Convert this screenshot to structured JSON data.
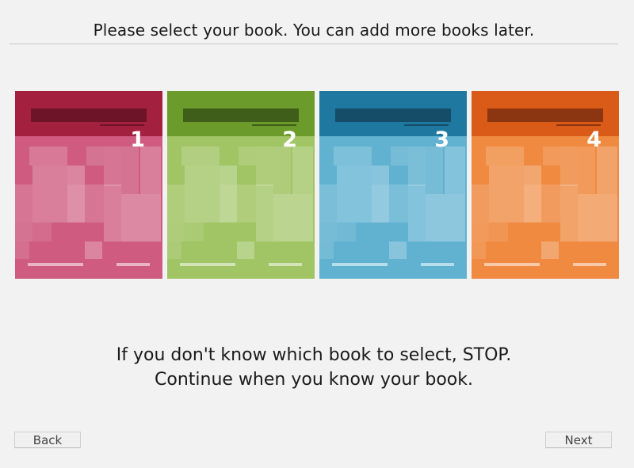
{
  "header": {
    "title": "Please select your book. You can add more books later."
  },
  "books": [
    {
      "number": "1",
      "top_color": "#a3213f",
      "body_color": "#cf5c80",
      "bar_color": "#6e1429",
      "line_color": "#6e1429"
    },
    {
      "number": "2",
      "top_color": "#6b9b2a",
      "body_color": "#a1c464",
      "bar_color": "#3f5e19",
      "line_color": "#3f5e19"
    },
    {
      "number": "3",
      "top_color": "#1f78a0",
      "body_color": "#61b2d1",
      "bar_color": "#154d68",
      "line_color": "#154d68"
    },
    {
      "number": "4",
      "top_color": "#da5a17",
      "body_color": "#ef8a40",
      "bar_color": "#8b3610",
      "line_color": "#8b3610"
    }
  ],
  "instructions": {
    "line1": "If you don't know which book to select, STOP.",
    "line2": "Continue when you know your book."
  },
  "nav": {
    "back_label": "Back",
    "next_label": "Next"
  }
}
